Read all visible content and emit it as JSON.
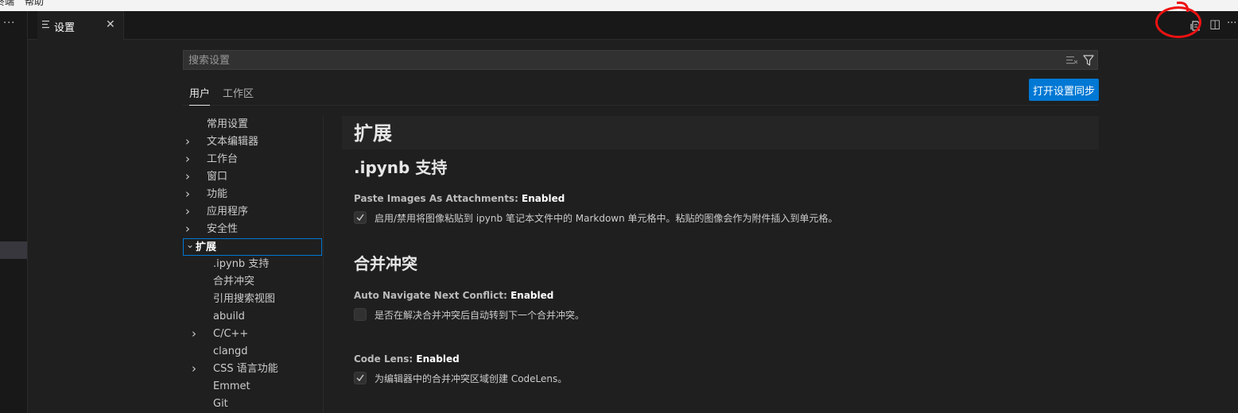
{
  "menubar": {
    "left_item": "终端",
    "help": "帮助"
  },
  "activity": {
    "more": "···"
  },
  "tab": {
    "label": "设置",
    "close": "✕"
  },
  "tab_actions": {
    "split": "◫",
    "more": "···"
  },
  "search": {
    "placeholder": "搜索设置",
    "value": ""
  },
  "scope_tabs": {
    "user": "用户",
    "workspace": "工作区"
  },
  "sync_button": "打开设置同步",
  "toc": [
    {
      "label": "常用设置",
      "chevron": "",
      "indent": 0
    },
    {
      "label": "文本编辑器",
      "chevron": "›",
      "indent": 0
    },
    {
      "label": "工作台",
      "chevron": "›",
      "indent": 0
    },
    {
      "label": "窗口",
      "chevron": "›",
      "indent": 0
    },
    {
      "label": "功能",
      "chevron": "›",
      "indent": 0
    },
    {
      "label": "应用程序",
      "chevron": "›",
      "indent": 0
    },
    {
      "label": "安全性",
      "chevron": "›",
      "indent": 0
    },
    {
      "label": "扩展",
      "chevron": "⌄",
      "indent": 0,
      "selected": true
    },
    {
      "label": ".ipynb 支持",
      "chevron": "",
      "indent": 1
    },
    {
      "label": "合并冲突",
      "chevron": "",
      "indent": 1
    },
    {
      "label": "引用搜索视图",
      "chevron": "",
      "indent": 1
    },
    {
      "label": "abuild",
      "chevron": "",
      "indent": 1
    },
    {
      "label": "C/C++",
      "chevron": "›",
      "indent": 1
    },
    {
      "label": "clangd",
      "chevron": "",
      "indent": 1
    },
    {
      "label": "CSS 语言功能",
      "chevron": "›",
      "indent": 1
    },
    {
      "label": "Emmet",
      "chevron": "",
      "indent": 1
    },
    {
      "label": "Git",
      "chevron": "",
      "indent": 1
    }
  ],
  "content": {
    "section_title": "扩展",
    "groups": [
      {
        "title": ".ipynb 支持",
        "settings": [
          {
            "category": "Paste Images As Attachments: ",
            "value": "Enabled",
            "checked": true,
            "description": "启用/禁用将图像粘贴到 ipynb 笔记本文件中的 Markdown 单元格中。粘贴的图像会作为附件插入到单元格。"
          }
        ]
      },
      {
        "title": "合并冲突",
        "settings": [
          {
            "category": "Auto Navigate Next Conflict: ",
            "value": "Enabled",
            "checked": false,
            "description": "是否在解决合并冲突后自动转到下一个合并冲突。"
          },
          {
            "category": "Code Lens: ",
            "value": "Enabled",
            "checked": true,
            "description": "为编辑器中的合并冲突区域创建 CodeLens。"
          }
        ]
      }
    ]
  },
  "colors": {
    "background": "#1f1f1f",
    "accent": "#0078d4",
    "annotation": "#ee1111"
  }
}
